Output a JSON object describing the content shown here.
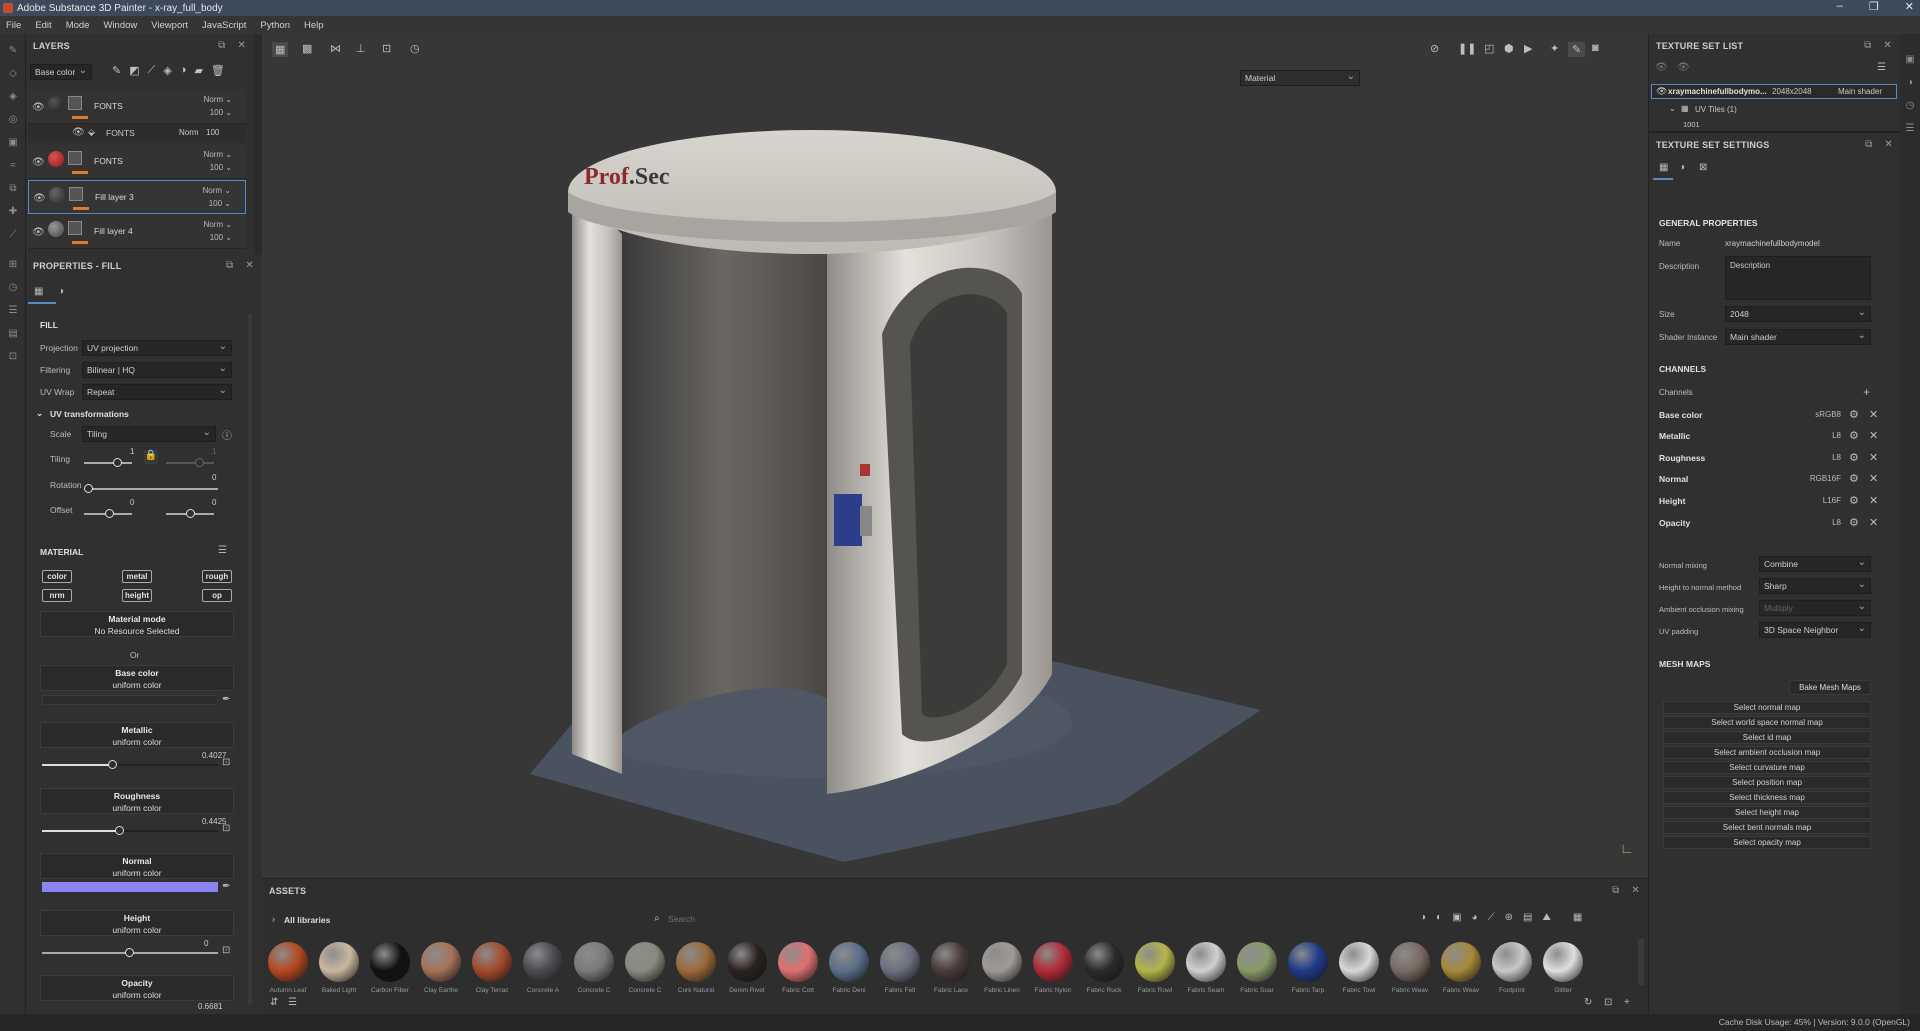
{
  "window": {
    "title": "Adobe Substance 3D Painter - x-ray_full_body"
  },
  "menu": [
    "File",
    "Edit",
    "Mode",
    "Window",
    "Viewport",
    "JavaScript",
    "Python",
    "Help"
  ],
  "layers": {
    "title": "LAYERS",
    "channel_dropdown": "Base color",
    "items": [
      {
        "name": "FONTS",
        "blend": "Norm",
        "opacity": "100",
        "thumb": "#1c1c1c"
      },
      {
        "name": "FONTS",
        "blend": "Norm",
        "opacity": "100",
        "thumb": "#b02a2a"
      },
      {
        "name": "Fill layer 3",
        "blend": "Norm",
        "opacity": "100",
        "thumb": "#3a3a3a"
      },
      {
        "name": "Fill layer 4",
        "blend": "Norm",
        "opacity": "100",
        "thumb": "#6a6a6a"
      }
    ],
    "sublayer": {
      "name": "FONTS",
      "blend": "Norm",
      "opacity": "100"
    }
  },
  "properties": {
    "title": "PROPERTIES - FILL",
    "fill_header": "FILL",
    "projection_label": "Projection",
    "projection_value": "UV projection",
    "filtering_label": "Filtering",
    "filtering_value": "Bilinear | HQ",
    "uvwrap_label": "UV Wrap",
    "uvwrap_value": "Repeat",
    "uvtrans_header": "UV transformations",
    "scale_label": "Scale",
    "scale_value": "Tiling",
    "tiling_label": "Tiling",
    "tiling_val1": "1",
    "tiling_val2": "1",
    "rotation_label": "Rotation",
    "rotation_val": "0",
    "offset_label": "Offset",
    "offset_val1": "0",
    "offset_val2": "0",
    "material_header": "MATERIAL",
    "pills": [
      "color",
      "metal",
      "rough",
      "nrm",
      "height",
      "op"
    ],
    "material_mode": "Material mode",
    "no_resource": "No Resource Selected",
    "or": "Or",
    "base_color": "Base color",
    "uniform": "uniform color",
    "metallic": "Metallic",
    "metallic_val": "0.4027",
    "metallic_level": 0.4027,
    "roughness": "Roughness",
    "roughness_val": "0.4425",
    "roughness_level": 0.4425,
    "normal": "Normal",
    "normal_color": "#8b83f0",
    "height": "Height",
    "height_val": "0",
    "opacity": "Opacity",
    "opacity_val": "0.6681"
  },
  "viewport": {
    "mode_dropdown": "Material",
    "logo": {
      "prefix": "Prof",
      "suffix": "Sec"
    }
  },
  "assets": {
    "title": "ASSETS",
    "libraries": "All libraries",
    "search_placeholder": "Search",
    "items": [
      {
        "name": "Autumn Leaf",
        "color": "#b5481f"
      },
      {
        "name": "Baked Light",
        "color": "#c9b8a0"
      },
      {
        "name": "Carbon Fiber",
        "color": "#111111"
      },
      {
        "name": "Clay Earthe",
        "color": "#a57257"
      },
      {
        "name": "Clay Terrac",
        "color": "#a44a2c"
      },
      {
        "name": "Concrete A",
        "color": "#4a4a52"
      },
      {
        "name": "Concrete C",
        "color": "#7a7a7a"
      },
      {
        "name": "Concrete C",
        "color": "#8a8a80"
      },
      {
        "name": "Cork Natural",
        "color": "#9b6a3a"
      },
      {
        "name": "Denim Rivet",
        "color": "#2a2220"
      },
      {
        "name": "Fabric Cott",
        "color": "#e07070"
      },
      {
        "name": "Fabric Deni",
        "color": "#5a6f8a"
      },
      {
        "name": "Fabric Felt",
        "color": "#6a7080"
      },
      {
        "name": "Fabric Lace",
        "color": "#4a3a3a"
      },
      {
        "name": "Fabric Linen",
        "color": "#a09a96"
      },
      {
        "name": "Fabric Nylon",
        "color": "#b02a36"
      },
      {
        "name": "Fabric Ruck",
        "color": "#2a2a2a"
      },
      {
        "name": "Fabric Rowl",
        "color": "#b5b54a"
      },
      {
        "name": "Fabric Seam",
        "color": "#d0d0d0"
      },
      {
        "name": "Fabric Soar",
        "color": "#8a9a6a"
      },
      {
        "name": "Fabric Tarp",
        "color": "#1e3a8a"
      },
      {
        "name": "Fabric Towl",
        "color": "#d8d8d8"
      },
      {
        "name": "Fabric Weav",
        "color": "#7a6a62"
      },
      {
        "name": "Fabric Weav",
        "color": "#a68a3a"
      },
      {
        "name": "Footprint",
        "color": "#c8c8c8"
      },
      {
        "name": "Glitter",
        "color": "#e0e0e0"
      }
    ]
  },
  "texture_set_list": {
    "title": "TEXTURE SET LIST",
    "item": "xraymachinefullbodymo...",
    "size": "2048x2048",
    "shader": "Main shader",
    "uvtiles": "UV Tiles (1)",
    "tile": "1001"
  },
  "texture_set_settings": {
    "title": "TEXTURE SET SETTINGS",
    "general": "GENERAL PROPERTIES",
    "name_label": "Name",
    "name_value": "xraymachinefullbodymodel",
    "desc_label": "Description",
    "desc_value": "Description",
    "size_label": "Size",
    "size_value": "2048",
    "shader_label": "Shader Instance",
    "shader_value": "Main shader",
    "channels_header": "CHANNELS",
    "channels_label": "Channels",
    "channels": [
      {
        "name": "Base color",
        "format": "sRGB8"
      },
      {
        "name": "Metallic",
        "format": "L8"
      },
      {
        "name": "Roughness",
        "format": "L8"
      },
      {
        "name": "Normal",
        "format": "RGB16F"
      },
      {
        "name": "Height",
        "format": "L16F"
      },
      {
        "name": "Opacity",
        "format": "L8"
      }
    ],
    "normal_mixing_label": "Normal mixing",
    "normal_mixing_value": "Combine",
    "h2n_label": "Height to normal method",
    "h2n_value": "Sharp",
    "ao_label": "Ambient occlusion mixing",
    "ao_value": "Multiply",
    "uvpad_label": "UV padding",
    "uvpad_value": "3D Space Neighbor",
    "meshmaps_header": "MESH MAPS",
    "bake_button": "Bake Mesh Maps",
    "meshmaps": [
      "Select normal map",
      "Select world space normal map",
      "Select id map",
      "Select ambient occlusion map",
      "Select curvature map",
      "Select position map",
      "Select thickness map",
      "Select height map",
      "Select bent normals map",
      "Select opacity map"
    ]
  },
  "status": {
    "text": "Cache Disk Usage:   45% | Version: 9.0.0 (OpenGL)"
  }
}
